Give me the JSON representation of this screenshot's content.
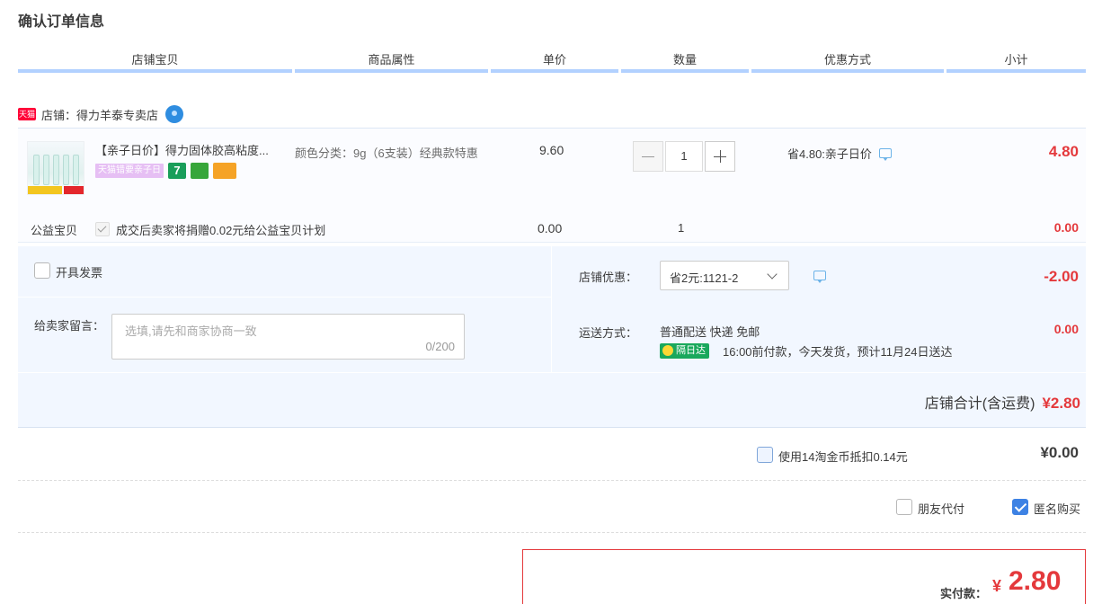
{
  "page": {
    "title": "确认订单信息"
  },
  "columns": [
    "店铺宝贝",
    "商品属性",
    "单价",
    "数量",
    "优惠方式",
    "小计"
  ],
  "shop": {
    "badge": "天猫",
    "label": "店铺：得力羊泰专卖店"
  },
  "item": {
    "title": "【亲子日价】得力固体胶高粘度...",
    "promo_pill": "天猫错要亲子日",
    "promo_seven": "7",
    "attr": "颜色分类：9g（6支装）经典款特惠",
    "price": "9.60",
    "quantity": "1",
    "discount": "省4.80:亲子日价",
    "subtotal": "4.80"
  },
  "charity": {
    "label": "公益宝贝",
    "text": "成交后卖家将捐赠0.02元给公益宝贝计划",
    "price": "0.00",
    "quantity": "1",
    "subtotal": "0.00"
  },
  "invoice": {
    "label": "开具发票",
    "checked": false
  },
  "memo": {
    "label": "给卖家留言：",
    "placeholder": "选填,请先和商家协商一致",
    "count": "0/200"
  },
  "shop_discount": {
    "label": "店铺优惠：",
    "selected": "省2元:1121-2",
    "amount": "-2.00"
  },
  "shipping": {
    "label": "运送方式：",
    "method": "普通配送 快递 免邮",
    "badge": "隔日达",
    "note": "16:00前付款，今天发货，预计11月24日送达",
    "fee": "0.00"
  },
  "shop_total": {
    "label": "店铺合计(含运费)",
    "amount": "¥2.80"
  },
  "coins": {
    "label": "使用14淘金币抵扣0.14元",
    "amount": "¥0.00",
    "checked": false
  },
  "pay_options": {
    "friend_label": "朋友代付",
    "friend_checked": false,
    "anon_label": "匿名购买",
    "anon_checked": true
  },
  "final": {
    "label": "实付款：",
    "currency": "¥",
    "amount": "2.80"
  },
  "colors": {
    "accent_red": "#e4393c",
    "header_underline": "#b2d1ff",
    "panel_bg": "#f2f7ff",
    "check_blue": "#3d82e4"
  }
}
